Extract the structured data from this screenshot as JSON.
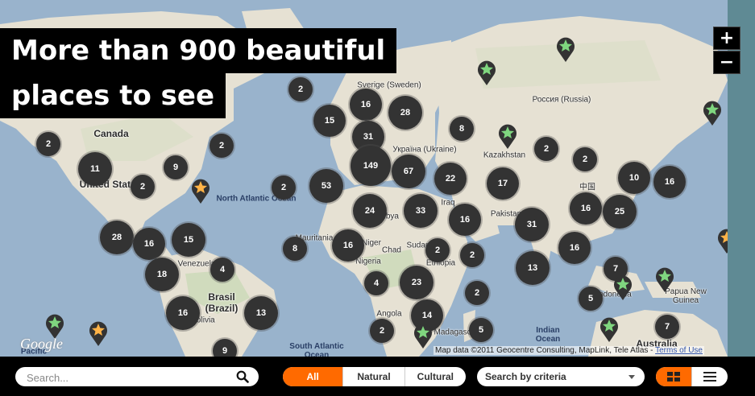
{
  "headline": {
    "line1": "More than 900 beautiful",
    "line2": "places to see"
  },
  "zoom": {
    "plus": "+",
    "minus": "−"
  },
  "attribution": {
    "text": "Map data ©2011 Geocentre Consulting, MapLink, Tele Atlas - ",
    "link": "Terms of Use"
  },
  "google_logo": "Google",
  "labels": [
    {
      "text": "Canada",
      "big": true
    },
    {
      "text": "United States",
      "big": true
    },
    {
      "text": "North Atlantic Ocean",
      "ocean": true
    },
    {
      "text": "Sverige (Sweden)"
    },
    {
      "text": "Россия (Russia)"
    },
    {
      "text": "Україна (Ukraine)"
    },
    {
      "text": "Kazakhstan"
    },
    {
      "text": "中国"
    },
    {
      "text": "Pakistan"
    },
    {
      "text": "Iraq"
    },
    {
      "text": "Libya"
    },
    {
      "text": "Sudan"
    },
    {
      "text": "Chad"
    },
    {
      "text": "Niger"
    },
    {
      "text": "Mauritania"
    },
    {
      "text": "Nigeria"
    },
    {
      "text": "Ethiopia"
    },
    {
      "text": "Venezuela"
    },
    {
      "text": "Brasil (Brazil)",
      "big": true
    },
    {
      "text": "Bolivia"
    },
    {
      "text": "Angola"
    },
    {
      "text": "Madagascar"
    },
    {
      "text": "South Atlantic Ocean",
      "ocean": true
    },
    {
      "text": "Indian Ocean",
      "ocean": true
    },
    {
      "text": "Australia",
      "big": true
    },
    {
      "text": "Papua New Guinea"
    },
    {
      "text": "Indonesia"
    },
    {
      "text": "Pacific"
    }
  ],
  "clusters": [
    {
      "label": "2"
    },
    {
      "label": "16"
    },
    {
      "label": "28"
    },
    {
      "label": "15"
    },
    {
      "label": "31"
    },
    {
      "label": "8"
    },
    {
      "label": "2"
    },
    {
      "label": "2"
    },
    {
      "label": "11"
    },
    {
      "label": "9"
    },
    {
      "label": "2"
    },
    {
      "label": "149"
    },
    {
      "label": "67"
    },
    {
      "label": "22"
    },
    {
      "label": "17"
    },
    {
      "label": "2"
    },
    {
      "label": "2"
    },
    {
      "label": "10"
    },
    {
      "label": "16"
    },
    {
      "label": "2"
    },
    {
      "label": "53"
    },
    {
      "label": "24"
    },
    {
      "label": "33"
    },
    {
      "label": "16"
    },
    {
      "label": "16"
    },
    {
      "label": "25"
    },
    {
      "label": "31"
    },
    {
      "label": "28"
    },
    {
      "label": "16"
    },
    {
      "label": "15"
    },
    {
      "label": "8"
    },
    {
      "label": "16"
    },
    {
      "label": "2"
    },
    {
      "label": "2"
    },
    {
      "label": "16"
    },
    {
      "label": "18"
    },
    {
      "label": "4"
    },
    {
      "label": "13"
    },
    {
      "label": "7"
    },
    {
      "label": "4"
    },
    {
      "label": "23"
    },
    {
      "label": "2"
    },
    {
      "label": "16"
    },
    {
      "label": "13"
    },
    {
      "label": "5"
    },
    {
      "label": "14"
    },
    {
      "label": "5"
    },
    {
      "label": "2"
    },
    {
      "label": "7"
    },
    {
      "label": "9"
    }
  ],
  "pins": [
    {
      "kind": "green"
    },
    {
      "kind": "green"
    },
    {
      "kind": "green"
    },
    {
      "kind": "green"
    },
    {
      "kind": "orange"
    },
    {
      "kind": "green"
    },
    {
      "kind": "green"
    },
    {
      "kind": "green"
    },
    {
      "kind": "orange"
    },
    {
      "kind": "green"
    },
    {
      "kind": "green"
    },
    {
      "kind": "orange"
    }
  ],
  "toolbar": {
    "search_placeholder": "Search...",
    "filters": [
      {
        "label": "All",
        "active": true
      },
      {
        "label": "Natural"
      },
      {
        "label": "Cultural"
      }
    ],
    "criteria_label": "Search by criteria",
    "accent": "#ff6a00"
  }
}
